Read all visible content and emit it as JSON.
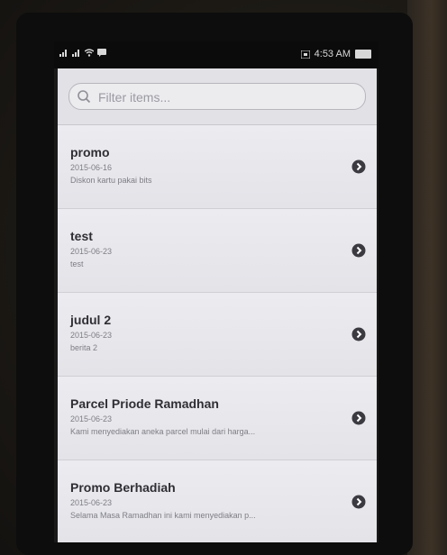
{
  "status_bar": {
    "time": "4:53 AM"
  },
  "search": {
    "placeholder": "Filter items..."
  },
  "items": [
    {
      "title": "promo",
      "date": "2015-06-16",
      "desc": "Diskon kartu pakai bits"
    },
    {
      "title": "test",
      "date": "2015-06-23",
      "desc": "test"
    },
    {
      "title": "judul 2",
      "date": "2015-06-23",
      "desc": "berita 2"
    },
    {
      "title": "Parcel Priode Ramadhan",
      "date": "2015-06-23",
      "desc": "Kami menyediakan aneka parcel mulai dari harga..."
    },
    {
      "title": "Promo Berhadiah",
      "date": "2015-06-23",
      "desc": "Selama Masa Ramadhan ini kami menyediakan p..."
    }
  ],
  "colors": {
    "screen_bg": "#e6e6ea",
    "title_text": "#2e2e34",
    "meta_text": "#7d7d85",
    "chevron": "#3a3a40"
  },
  "icons": {
    "search": "search-icon",
    "chevron": "chevron-right-circle-icon"
  }
}
